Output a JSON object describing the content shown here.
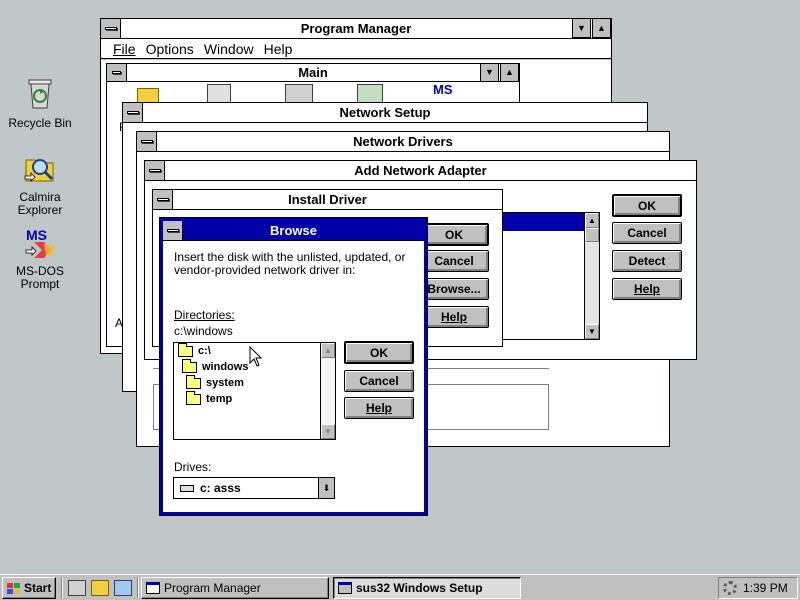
{
  "desktop": {
    "icons": [
      {
        "label": "Recycle Bin",
        "icon": "recycle-bin-icon"
      },
      {
        "label": "Calmira\nExplorer",
        "icon": "explorer-icon"
      },
      {
        "label": "MS-DOS\nPrompt",
        "icon": "msdos-icon"
      }
    ]
  },
  "program_manager": {
    "title": "Program Manager",
    "menu": [
      "File",
      "Options",
      "Window",
      "Help"
    ],
    "main_title": "Main",
    "partial_f": "F",
    "partial_ac": "Ac"
  },
  "network_setup": {
    "title": "Network Setup"
  },
  "network_drivers": {
    "title": "Network Drivers"
  },
  "add_adapter": {
    "title": "Add Network Adapter",
    "buttons": {
      "ok": "OK",
      "cancel": "Cancel",
      "detect": "Detect",
      "help": "Help"
    }
  },
  "install_driver": {
    "title": "Install Driver",
    "buttons": {
      "ok": "OK",
      "cancel": "Cancel",
      "browse": "Browse...",
      "help": "Help"
    }
  },
  "browse": {
    "title": "Browse",
    "instruction": "Insert the disk with the unlisted, updated, or vendor-provided network driver in:",
    "directories_label": "Directories:",
    "current_path": "c:\\windows",
    "tree": [
      {
        "name": "c:\\",
        "level": 0,
        "open": true
      },
      {
        "name": "windows",
        "level": 1,
        "open": true
      },
      {
        "name": "system",
        "level": 2,
        "open": false
      },
      {
        "name": "temp",
        "level": 2,
        "open": false
      }
    ],
    "drives_label": "Drives:",
    "drive_value": "c: asss",
    "buttons": {
      "ok": "OK",
      "cancel": "Cancel",
      "help": "Help"
    }
  },
  "taskbar": {
    "start_label": "Start",
    "tasks": [
      {
        "label": "Program Manager"
      },
      {
        "label": "sus32 Windows Setup"
      }
    ],
    "clock": "1:39 PM"
  },
  "colors": {
    "active_title": "#0000a8",
    "desktop": "#c0c7c8",
    "face": "#c0c0c0"
  }
}
